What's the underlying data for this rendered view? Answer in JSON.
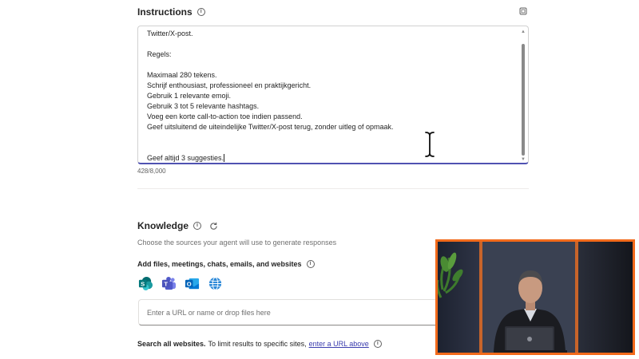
{
  "instructions": {
    "title": "Instructions",
    "lines": [
      "Twitter/X-post.",
      "",
      "Regels:",
      "",
      "Maximaal 280 tekens.",
      "Schrijf enthousiast, professioneel en praktijkgericht.",
      "Gebruik 1 relevante emoji.",
      "Gebruik 3 tot 5 relevante hashtags.",
      "Voeg een korte call-to-action toe indien passend.",
      "Geef uitsluitend de uiteindelijke Twitter/X-post terug, zonder uitleg of opmaak.",
      "",
      "",
      "Geef altijd 3 suggesties."
    ],
    "char_count": "428/8,000"
  },
  "knowledge": {
    "title": "Knowledge",
    "description": "Choose the sources your agent will use to generate responses",
    "add_label": "Add files, meetings, chats, emails, and websites",
    "source_icons": [
      "sharepoint-icon",
      "teams-icon",
      "outlook-icon",
      "globe-icon"
    ],
    "url_placeholder": "Enter a URL or name or drop files here",
    "search_all_bold": "Search all websites.",
    "search_all_text": "To limit results to specific sites,",
    "search_all_link": "enter a URL above"
  },
  "colors": {
    "accent": "#4f52b2",
    "link": "#3b3dae",
    "pip_border": "#f26a1b"
  }
}
